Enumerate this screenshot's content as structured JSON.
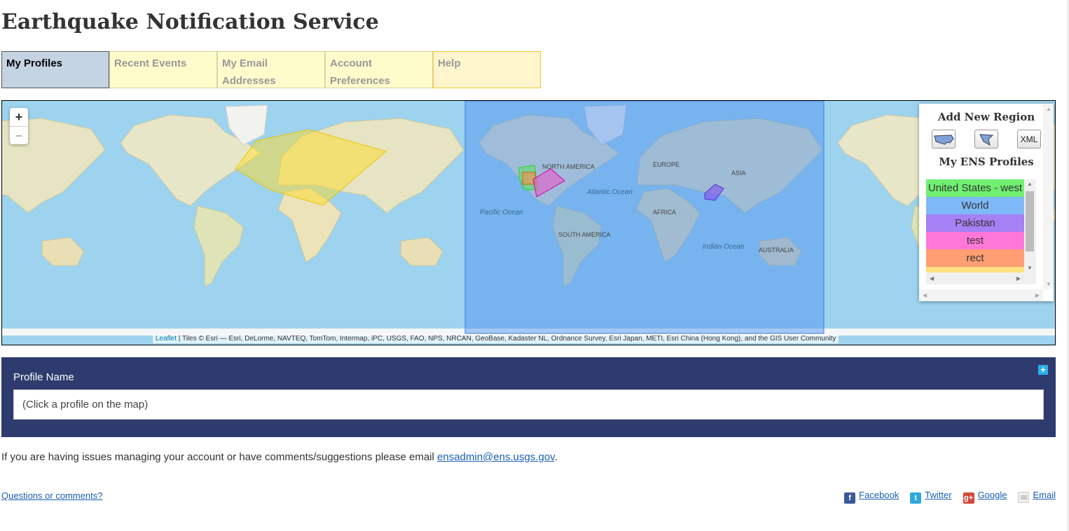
{
  "title": "Earthquake Notification Service",
  "tabs": [
    {
      "label": "My Profiles",
      "active": true
    },
    {
      "label": "Recent Events"
    },
    {
      "label": "My Email Addresses"
    },
    {
      "label": "Account Preferences"
    },
    {
      "label": "Help"
    }
  ],
  "map": {
    "zoom_in": "+",
    "zoom_out": "−",
    "labels": {
      "north_america": "NORTH AMERICA",
      "europe": "EUROPE",
      "asia": "ASIA",
      "africa": "AFRICA",
      "south_america": "SOUTH AMERICA",
      "australia": "AUSTRALIA",
      "pacific": "Pacific Ocean",
      "atlantic": "Atlantic Ocean",
      "indian": "Indian Ocean"
    },
    "attribution_link": "Leaflet",
    "attribution": " | Tiles © Esri — Esri, DeLorme, NAVTEQ, TomTom, Intermap, iPC, USGS, FAO, NPS, NRCAN, GeoBase, Kadaster NL, Ordnance Survey, Esri Japan, METI, Esri China (Hong Kong), and the GIS User Community"
  },
  "panel": {
    "add_title": "Add New Region",
    "buttons": [
      {
        "icon": "us-map-icon"
      },
      {
        "icon": "polygon-icon"
      },
      {
        "label": "XML"
      }
    ],
    "profiles_title": "My ENS Profiles",
    "profiles": [
      {
        "name": "United States - west",
        "color": "#70f070"
      },
      {
        "name": "World",
        "color": "#7fb8f8"
      },
      {
        "name": "Pakistan",
        "color": "#a680f5"
      },
      {
        "name": "test",
        "color": "#ff78d8"
      },
      {
        "name": "rect",
        "color": "#ff9e72"
      },
      {
        "name": "",
        "color": "#ffe080"
      }
    ]
  },
  "form": {
    "label": "Profile Name",
    "value": "(Click a profile on the map)"
  },
  "footer": {
    "message": "If you are having issues managing your account or have comments/suggestions please email ",
    "email": "ensadmin@ens.usgs.gov",
    "message_end": ".",
    "questions": "Questions or comments?",
    "social": [
      {
        "label": "Facebook",
        "color": "#3b5998"
      },
      {
        "label": "Twitter",
        "color": "#2fa8df"
      },
      {
        "label": "Google",
        "color": "#d34836"
      },
      {
        "label": "Email",
        "color": "#ddd"
      }
    ]
  }
}
